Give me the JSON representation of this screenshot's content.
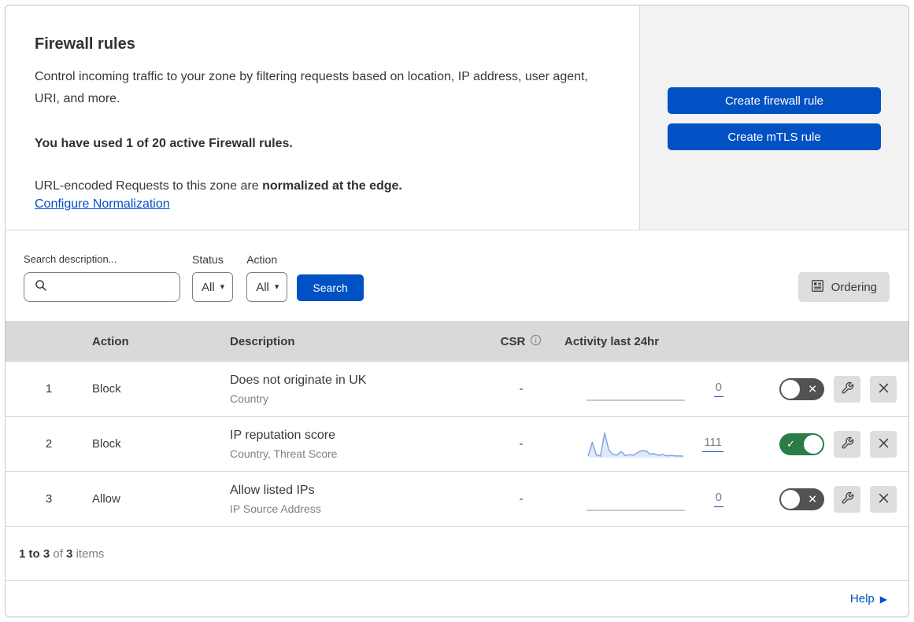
{
  "colors": {
    "accent": "#0051c3",
    "panel_bg": "#f2f2f2",
    "thead_bg": "#d9d9d9",
    "toggle_on": "#2c7c47",
    "toggle_off": "#545250",
    "spark_line": "#7aa1e4",
    "spark_fill": "#e1eaf9"
  },
  "icons": {
    "check": "✓",
    "cross": "✕",
    "caret_down": "▾",
    "forward_arrow": "▶"
  },
  "intro": {
    "title": "Firewall rules",
    "description": "Control incoming traffic to your zone by filtering requests based on location, IP address, user agent, URI, and more.",
    "usage": "You have used 1 of 20 active Firewall rules.",
    "normalization_prefix": "URL-encoded Requests to this zone are",
    "normalization_bold": "normalized at the edge.",
    "normalization_link": "Configure Normalization"
  },
  "actions": {
    "create_firewall_rule": "Create firewall rule",
    "create_mtls_rule": "Create mTLS rule"
  },
  "filters": {
    "search_label": "Search description...",
    "status_label": "Status",
    "status_value": "All",
    "action_label": "Action",
    "action_value": "All",
    "search_button": "Search",
    "ordering_button": "Ordering"
  },
  "table": {
    "headers": {
      "action": "Action",
      "description": "Description",
      "csr": "CSR",
      "activity": "Activity last 24hr"
    },
    "rows": [
      {
        "number": "1",
        "action": "Block",
        "title": "Does not originate in UK",
        "subtitle": "Country",
        "csr": "-",
        "count": "0",
        "enabled": false
      },
      {
        "number": "2",
        "action": "Block",
        "title": "IP reputation score",
        "subtitle": "Country, Threat Score",
        "csr": "-",
        "count": "111",
        "enabled": true,
        "sparkline": [
          4,
          60,
          8,
          3,
          98,
          28,
          10,
          7,
          22,
          5,
          9,
          7,
          18,
          26,
          24,
          11,
          13,
          6,
          10,
          4,
          6,
          4,
          4,
          3
        ]
      },
      {
        "number": "3",
        "action": "Allow",
        "title": "Allow listed IPs",
        "subtitle": "IP Source Address",
        "csr": "-",
        "count": "0",
        "enabled": false
      }
    ]
  },
  "footer": {
    "range": "1 to 3",
    "of": "of",
    "total": "3",
    "items": "items"
  },
  "help": {
    "label": "Help"
  }
}
